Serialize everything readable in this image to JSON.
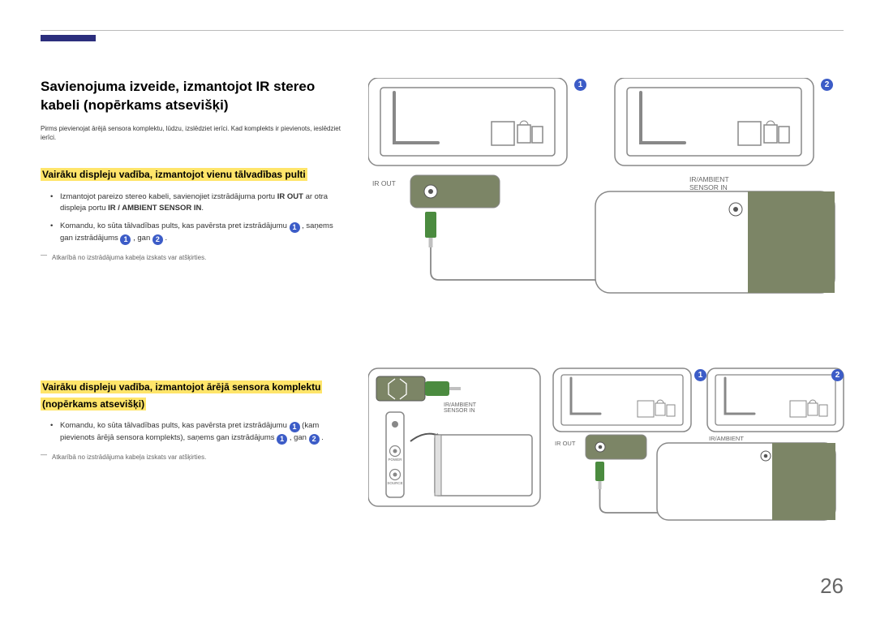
{
  "page_number": "26",
  "heading": "Savienojuma izveide, izmantojot IR stereo kabeli (nopērkams atsevišķi)",
  "intro": "Pirms pievienojat ārējā sensora komplektu, lūdzu, izslēdziet ierīci. Kad komplekts ir pievienots, ieslēdziet ierīci.",
  "section1": {
    "title": "Vairāku displeju vadība, izmantojot vienu tālvadības pulti",
    "bullets": {
      "b1_pre": "Izmantojot pareizo stereo kabeli, savienojiet izstrādājuma portu ",
      "b1_bold1": "IR OUT",
      "b1_mid": " ar otra displeja portu ",
      "b1_bold2": "IR / AMBIENT SENSOR IN",
      "b1_post": ".",
      "b2_pre": "Komandu, ko sūta tālvadības pults, kas pavērsta pret izstrādājumu ",
      "b2_mid": " , saņems gan izstrādājums ",
      "b2_mid2": " , gan ",
      "b2_post": " ."
    },
    "note": "Atkarībā no izstrādājuma kabeļa izskats var atšķirties."
  },
  "section2": {
    "title": "Vairāku displeju vadība, izmantojot ārējā sensora komplektu (nopērkams atsevišķi)",
    "bullets": {
      "b1_pre": "Komandu, ko sūta tālvadības pults, kas pavērsta pret izstrādājumu ",
      "b1_mid1": "  (kam pievienots ārējā sensora komplekts), saņems gan izstrādājums ",
      "b1_mid2": " , gan ",
      "b1_post": " ."
    },
    "note": "Atkarībā no izstrādājuma kabeļa izskats var atšķirties."
  },
  "labels": {
    "ir_out": "IR OUT",
    "ir_ambient": "IR/AMBIENT",
    "sensor_in": "SENSOR IN",
    "ir_ambient_sensor_in": "IR/AMBIENT SENSOR IN",
    "power": "POWER",
    "source": "SOURCE"
  },
  "badges": {
    "one": "1",
    "two": "2"
  },
  "colors": {
    "accent": "#2B2E7D",
    "highlight": "#FFE56A",
    "badge": "#3C5CC7",
    "olive": "#7C8566",
    "green": "#4B8B3F",
    "blue": "#3C8BC3",
    "grey": "#888"
  }
}
